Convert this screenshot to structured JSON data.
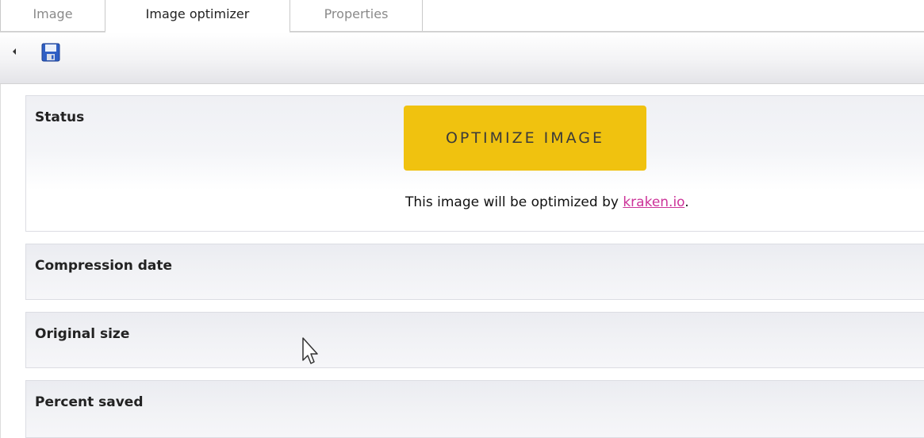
{
  "tabs": [
    {
      "label": "Image",
      "active": false
    },
    {
      "label": "Image optimizer",
      "active": true
    },
    {
      "label": "Properties",
      "active": false
    }
  ],
  "toolbar": {
    "collapse_icon": "caret-left-icon",
    "save_icon": "floppy-disk-icon"
  },
  "status": {
    "label": "Status",
    "button_label": "OPTIMIZE IMAGE",
    "note_prefix": "This image will be optimized by ",
    "note_link": "kraken.io",
    "note_suffix": "."
  },
  "fields": {
    "compression_date": {
      "label": "Compression date",
      "value": ""
    },
    "original_size": {
      "label": "Original size",
      "value": ""
    },
    "percent_saved": {
      "label": "Percent saved",
      "value": ""
    }
  },
  "colors": {
    "button": "#f0c20f",
    "link": "#cc3399"
  }
}
